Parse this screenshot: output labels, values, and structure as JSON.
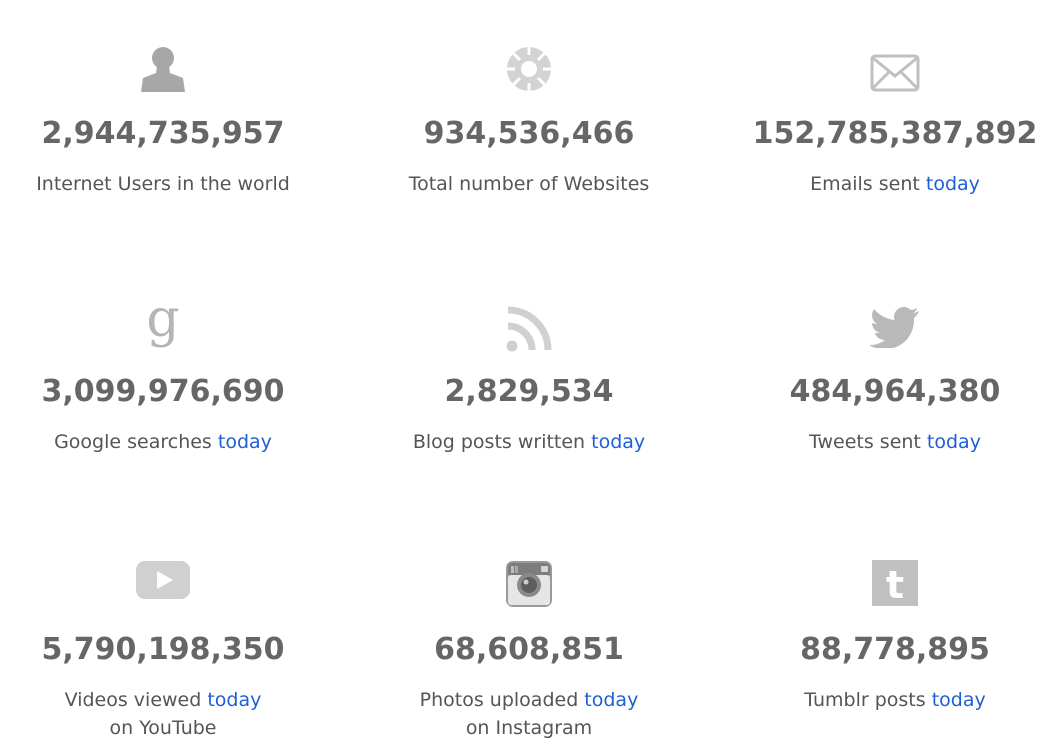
{
  "colors": {
    "number": "#666666",
    "text": "#555555",
    "link": "#1f5fd6",
    "icon": "#aaaaaa"
  },
  "stats": [
    {
      "icon": "user-icon",
      "count": "2,944,735,957",
      "label": "Internet Users in the world",
      "link": "",
      "line2": ""
    },
    {
      "icon": "globe-icon",
      "count": "934,536,466",
      "label": "Total number of Websites",
      "link": "",
      "line2": ""
    },
    {
      "icon": "envelope-icon",
      "count": "152,785,387,892",
      "label": "Emails sent ",
      "link": "today",
      "line2": ""
    },
    {
      "icon": "google-icon",
      "count": "3,099,976,690",
      "label": "Google searches ",
      "link": "today",
      "line2": ""
    },
    {
      "icon": "rss-icon",
      "count": "2,829,534",
      "label": "Blog posts written ",
      "link": "today",
      "line2": ""
    },
    {
      "icon": "twitter-icon",
      "count": "484,964,380",
      "label": "Tweets sent ",
      "link": "today",
      "line2": ""
    },
    {
      "icon": "youtube-icon",
      "count": "5,790,198,350",
      "label": "Videos viewed ",
      "link": "today",
      "line2": "on YouTube"
    },
    {
      "icon": "instagram-icon",
      "count": "68,608,851",
      "label": "Photos uploaded ",
      "link": "today",
      "line2": "on Instagram"
    },
    {
      "icon": "tumblr-icon",
      "count": "88,778,895",
      "label": "Tumblr posts ",
      "link": "today",
      "line2": ""
    }
  ]
}
